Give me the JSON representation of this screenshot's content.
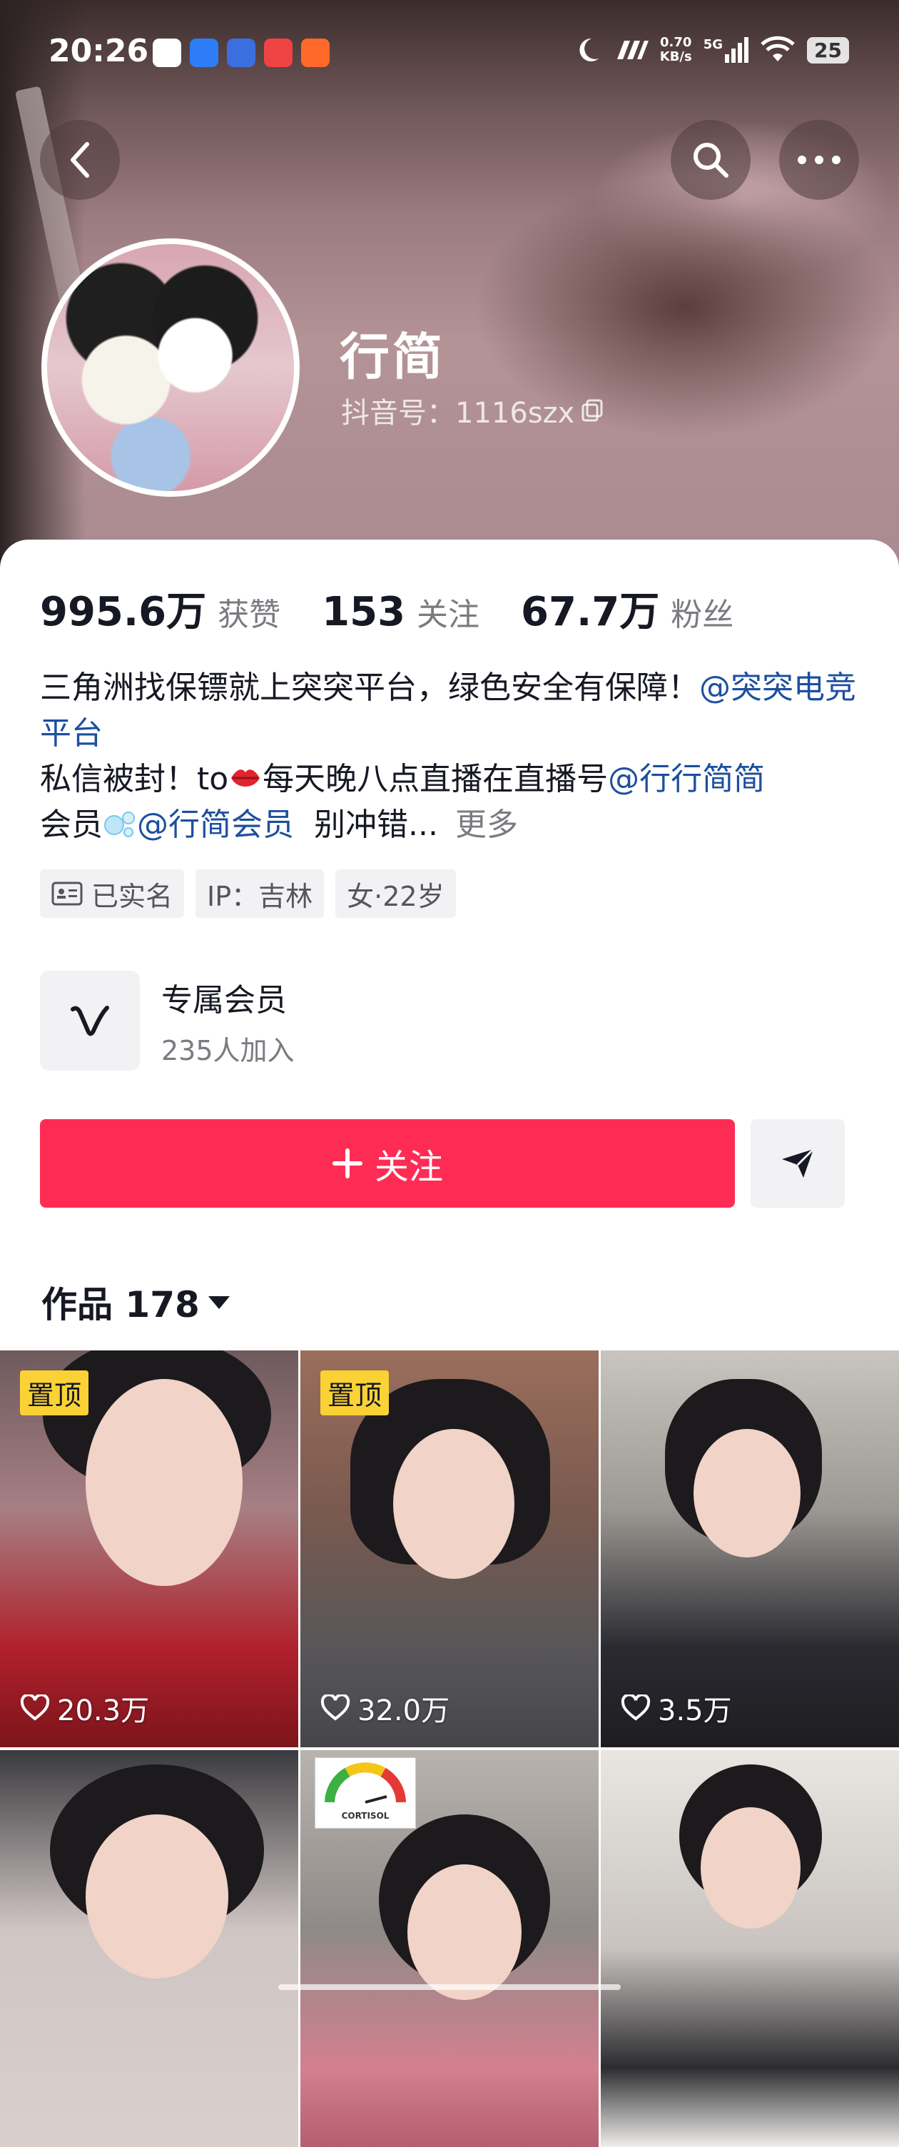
{
  "status_bar": {
    "time": "20:26",
    "speed_top": "0.70",
    "speed_bottom": "KB/s",
    "network": "5G",
    "battery": "25",
    "app_icons": [
      "qq-icon",
      "browser-icon",
      "tieba-icon",
      "video-app-icon",
      "store-app-icon"
    ]
  },
  "profile": {
    "nickname": "行简",
    "douyin_id": "抖音号：1116szx"
  },
  "stats": [
    {
      "value": "995.6万",
      "label": "获赞"
    },
    {
      "value": "153",
      "label": "关注"
    },
    {
      "value": "67.7万",
      "label": "粉丝"
    }
  ],
  "bio": {
    "line1_text": "三角洲找保镖就上突突平台，绿色安全有保障！",
    "line1_mention": "@突突电竞平台",
    "line2_text_a": "私信被封！to",
    "line2_text_b": "每天晚八点直播在直播号",
    "line2_mention": "@行行简简",
    "line3_text": "会员",
    "line3_mention": "@行简会员",
    "line3_tail": "别冲错...",
    "more": "更多"
  },
  "tags": [
    {
      "label": "已实名",
      "icon": "id-card-icon"
    },
    {
      "label": "IP：吉林"
    },
    {
      "label": "女·22岁"
    }
  ],
  "membership": {
    "title": "专属会员",
    "subtitle": "235人加入"
  },
  "actions": {
    "follow": "关注"
  },
  "works": {
    "header": "作品 178"
  },
  "videos": [
    {
      "pinned": "置顶",
      "likes": "20.3万"
    },
    {
      "pinned": "置顶",
      "likes": "32.0万"
    },
    {
      "likes": "3.5万"
    },
    {},
    {
      "gauge_label": "CORTISOL"
    },
    {}
  ],
  "colors": {
    "accent": "#fe2c55",
    "mention": "#1d4f9e",
    "pin_badge": "#fbd235"
  }
}
